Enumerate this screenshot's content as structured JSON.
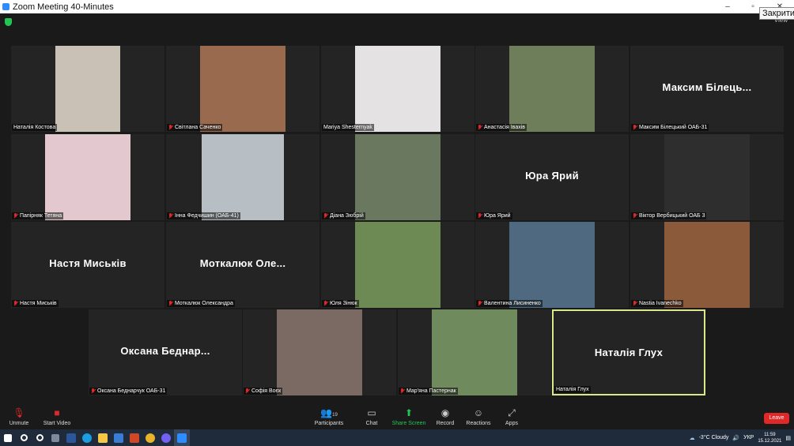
{
  "window": {
    "title": "Zoom Meeting 40-Minutes",
    "close_tooltip": "Закрити",
    "view_label": "View"
  },
  "tiles": [
    {
      "name": "Наталія Костова",
      "muted": false,
      "photo_color": "#c9c1b6",
      "photo_w": 82
    },
    {
      "name": "Світлана Саченко",
      "muted": true,
      "photo_color": "#9a6a4e",
      "photo_w": 108
    },
    {
      "name": "Mariya Shesternyak",
      "muted": false,
      "photo_color": "#e4e2e2",
      "photo_w": 108
    },
    {
      "name": "Анастасія Івахів",
      "muted": true,
      "photo_color": "#6f7e5a",
      "photo_w": 108
    },
    {
      "name": "Максим Білецький ОАБ-31",
      "big_name": "Максим Білець...",
      "muted": true
    },
    {
      "name": "Папірняк Тетяна",
      "muted": true,
      "photo_color": "#e3c9cf",
      "photo_w": 108
    },
    {
      "name": "Інна Федчишин (ОАБ-41)",
      "muted": true,
      "photo_color": "#b8bfc4",
      "photo_w": 104
    },
    {
      "name": "Діана Зюбрій",
      "muted": true,
      "photo_color": "#6a7860",
      "photo_w": 108
    },
    {
      "name": "Юра Ярий",
      "big_name": "Юра Ярий",
      "muted": true
    },
    {
      "name": "Віктор Вербицький ОАБ 3",
      "muted": true,
      "photo_color": "#2e2e2e",
      "photo_w": 108
    },
    {
      "name": "Настя Миськів",
      "big_name": "Настя Миськів",
      "muted": true
    },
    {
      "name": "Моткалюк Олександра",
      "big_name": "Моткалюк Оле...",
      "muted": true
    },
    {
      "name": "Юля Зінюк",
      "muted": true,
      "photo_color": "#6d8a55",
      "photo_w": 108
    },
    {
      "name": "Валентина Лисиненко",
      "muted": true,
      "photo_color": "#4f6a80",
      "photo_w": 108
    },
    {
      "name": "Nastia Ivanechko",
      "muted": true,
      "photo_color": "#8a5a3a",
      "photo_w": 108
    },
    {
      "name": "Оксана Беднарчук ОАБ-31",
      "big_name": "Оксана  Беднар...",
      "muted": true
    },
    {
      "name": "Софія Воєк",
      "muted": true,
      "photo_color": "#7b6a63",
      "photo_w": 108
    },
    {
      "name": "Мар'яна Пастернак",
      "muted": true,
      "photo_color": "#6f8a5c",
      "photo_w": 108
    },
    {
      "name": "Наталія Глух",
      "big_name": "Наталія Глух",
      "muted": false,
      "active": true
    }
  ],
  "toolbar": {
    "unmute": "Unmute",
    "start_video": "Start Video",
    "participants": "Participants",
    "participants_count": "19",
    "chat": "Chat",
    "share_screen": "Share Screen",
    "record": "Record",
    "reactions": "Reactions",
    "apps": "Apps",
    "leave": "Leave"
  },
  "taskbar": {
    "weather": "-3°C  Cloudy",
    "language": "УКР",
    "time": "11:59",
    "date": "15.12.2021"
  },
  "colors": {
    "accent": "#2d8cff",
    "share": "#23c552",
    "leave": "#e02828",
    "active_border": "#d9e88a"
  }
}
